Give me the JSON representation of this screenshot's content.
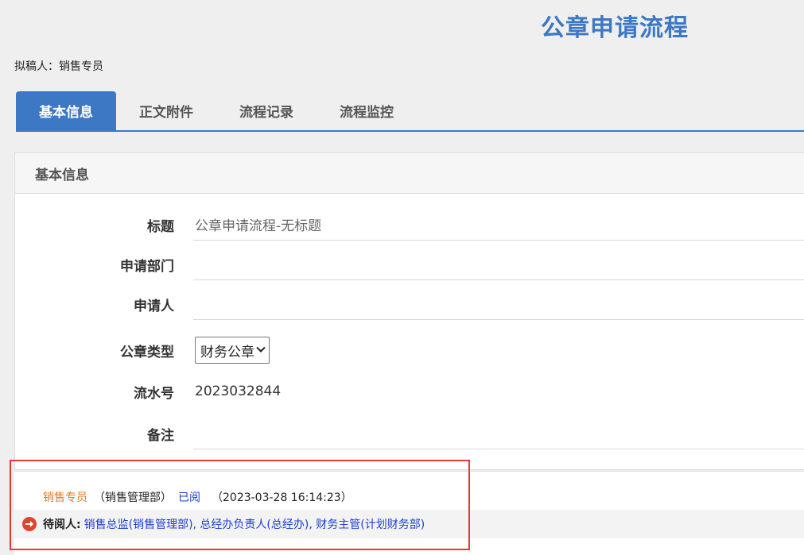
{
  "header": {
    "title": "公章申请流程",
    "drafter_label": "拟稿人：",
    "drafter_name": "销售专员"
  },
  "tabs": [
    {
      "label": "基本信息",
      "active": true
    },
    {
      "label": "正文附件",
      "active": false
    },
    {
      "label": "流程记录",
      "active": false
    },
    {
      "label": "流程监控",
      "active": false
    }
  ],
  "panel": {
    "title": "基本信息"
  },
  "form": {
    "title_label": "标题",
    "title_value": "公章申请流程-无标题",
    "dept_label": "申请部门",
    "dept_value": "",
    "applicant_label": "申请人",
    "applicant_value": "",
    "seal_type_label": "公章类型",
    "seal_type_value": "财务公章",
    "serial_label": "流水号",
    "serial_value": "2023032844",
    "remark_label": "备注",
    "remark_value": ""
  },
  "log": {
    "reader_name": "销售专员",
    "reader_dept": "（销售管理部）",
    "status": "已阅",
    "time": "（2023-03-28 16:14:23）",
    "pending_label": "待阅人:",
    "pending_list": "销售总监(销售管理部), 总经办负责人(总经办), 财务主管(计划财务部)"
  },
  "colors": {
    "accent": "#3c78c3",
    "link": "#1c3fcf",
    "name": "#e07b28",
    "alert": "#e0432e",
    "highlight": "#e23a3a"
  }
}
